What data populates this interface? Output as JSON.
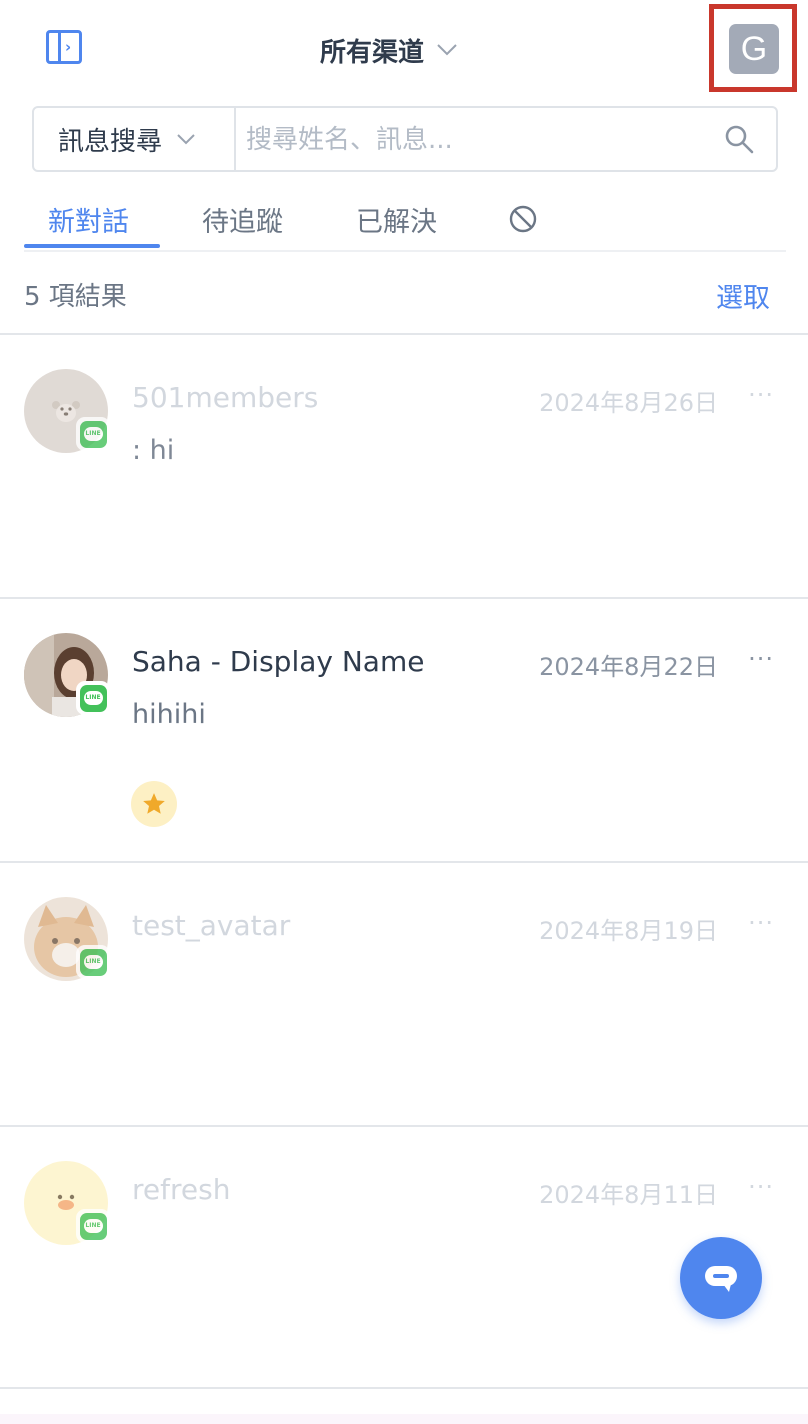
{
  "header": {
    "channel_title": "所有渠道",
    "account_initial": "G"
  },
  "search": {
    "scope_label": "訊息搜尋",
    "placeholder": "搜尋姓名、訊息..."
  },
  "tabs": [
    {
      "label": "新對話",
      "active": true
    },
    {
      "label": "待追蹤"
    },
    {
      "label": "已解決"
    }
  ],
  "results": {
    "count_text": "5 項結果",
    "select_label": "選取"
  },
  "conversations": [
    {
      "name": "501members",
      "date": "2024年8月26日",
      "preview": ": hi",
      "channel": "LINE"
    },
    {
      "name": "Saha - Display Name",
      "date": "2024年8月22日",
      "preview": "hihihi",
      "channel": "LINE",
      "starred": true
    },
    {
      "name": "test_avatar",
      "date": "2024年8月19日",
      "preview": "",
      "channel": "LINE"
    },
    {
      "name": "refresh",
      "date": "2024年8月11日",
      "preview": "",
      "channel": "LINE"
    }
  ],
  "more_label": "···",
  "badge_text": "LINE",
  "colors": {
    "accent": "#4f86ee",
    "line_green": "#43c15a",
    "highlight_border": "#c9372c",
    "star": "#f0a92a"
  },
  "icons": {
    "sidebar_toggle": "sidebar-toggle-icon",
    "channel_dropdown": "chevron-down-icon",
    "search": "search-icon",
    "blocked_tab": "block-icon",
    "star": "star-icon",
    "chat_fab": "chat-bubble-icon"
  }
}
